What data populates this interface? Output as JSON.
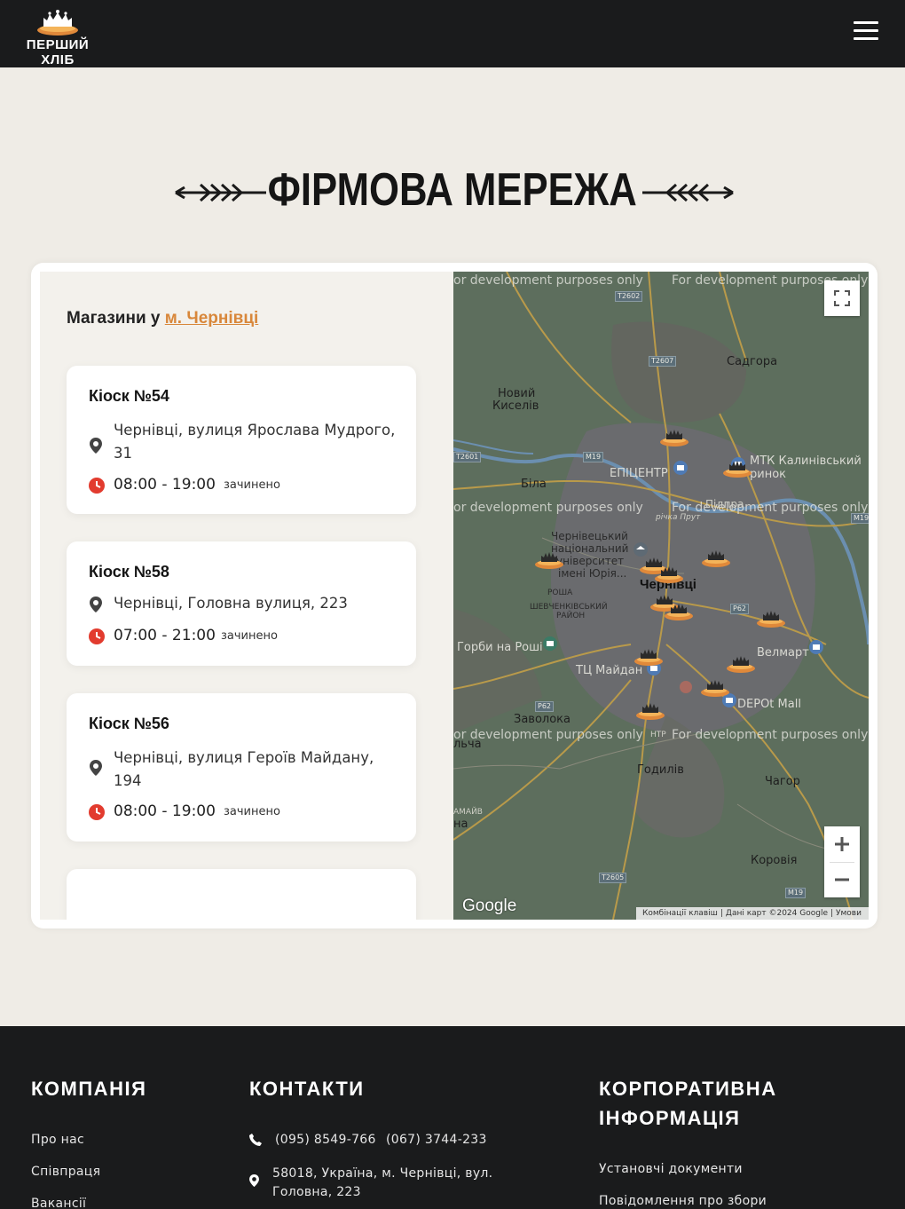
{
  "header": {
    "logo_text": "ПЕРШИЙ ХЛІБ",
    "menu_icon": "hamburger-menu-icon"
  },
  "section": {
    "title": "ФІРМОВА МЕРЕЖА"
  },
  "stores_panel": {
    "heading_prefix": "Магазини у",
    "city_link": "м. Чернівці",
    "stores": [
      {
        "name": "Кіоск №54",
        "address": "Чернівці, вулиця Ярослава Мудрого, 31",
        "hours": "08:00 - 19:00",
        "status": "зачинено"
      },
      {
        "name": "Кіоск №58",
        "address": "Чернівці, Головна вулиця, 223",
        "hours": "07:00 - 21:00",
        "status": "зачинено"
      },
      {
        "name": "Кіоск №56",
        "address": "Чернівці, вулиця Героїв Майдану, 194",
        "hours": "08:00 - 19:00",
        "status": "зачинено"
      }
    ]
  },
  "map": {
    "watermark": "For development purposes only",
    "watermark_cut": "or development purposes only",
    "labels": {
      "sadhora": "Садгора",
      "noviy_kyseliv_1": "Новий",
      "noviy_kyseliv_2": "Киселів",
      "bila": "Біла",
      "epicentr": "ЕПІЦЕНТР",
      "mtk_1": "МТК Калинівський",
      "mtk_2": "ринок",
      "pidpra": "Підпра",
      "prut": "річка Прут",
      "university_1": "Чернівецький",
      "university_2": "національний",
      "university_3": "університет",
      "university_4": "імені Юрія...",
      "chernivtsi": "Чернівці",
      "rosha": "РОША",
      "shevchenkivskyi_1": "ШЕВЧЕНКІВСЬКИЙ",
      "shevchenkivskyi_2": "РАЙОН",
      "gorby": "Горби на Роші",
      "tc_maidan": "ТЦ Майдан",
      "velmart": "Велмарт",
      "depot": "DEPOt Mall",
      "zavoloka": "Заволока",
      "lcha": "льча",
      "godyliv": "Годилів",
      "chagor": "Чагор",
      "koroviya": "Коровія",
      "mamaiana": "АМАЙВ",
      "na": "на",
      "ntr": "НТР"
    },
    "road_signs": [
      "T2602",
      "T2607",
      "M19",
      "T2601",
      "P62",
      "P62",
      "T2605",
      "M19",
      "M19"
    ],
    "google_logo": "Google",
    "attribution": [
      "Комбінації клавіш",
      "Дані карт ©2024 Google",
      "Умови"
    ],
    "fullscreen_icon": "fullscreen-icon",
    "zoom_in_icon": "plus-icon",
    "zoom_out_icon": "minus-icon",
    "marker_icon": "bread-basket-icon"
  },
  "footer": {
    "company": {
      "heading": "КОМПАНІЯ",
      "links": [
        "Про нас",
        "Співпраця",
        "Вакансії"
      ]
    },
    "contacts": {
      "heading": "КОНТАКТИ",
      "phone1": "(095) 8549-766",
      "phone2": "(067) 3744-233",
      "address": "58018, Україна, м. Чернівці, вул. Головна, 223"
    },
    "corporate": {
      "heading": "КОРПОРАТИВНА ІНФОРМАЦІЯ",
      "links": [
        "Установчі документи",
        "Повідомлення про збори"
      ]
    }
  },
  "colors": {
    "accent": "#d8873a",
    "dark_bg": "#1a1b1c",
    "page_bg": "#efece6",
    "clock_red": "#e23b2e"
  }
}
